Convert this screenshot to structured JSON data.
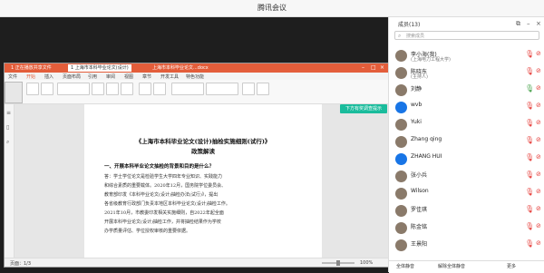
{
  "window": {
    "title": "腾讯会议"
  },
  "app": {
    "tabs": [
      "1 正在播放共享文件",
      "1 上海市本科毕业论文(设计)",
      "上海市本科毕业论文...docx"
    ],
    "ribbon_tabs": [
      "文件",
      "开始",
      "插入",
      "页面布局",
      "引用",
      "审阅",
      "视图",
      "章节",
      "开发工具",
      "特色功能"
    ],
    "active_ribbon_tab": "开始",
    "badge": "下方有奖调查提示",
    "document": {
      "title": "《上海市本科毕业论文(设计)抽检实施细则(试行)》",
      "subtitle": "政策解读",
      "section": "一、开展本科毕业论文抽检的背景和目的是什么？",
      "paragraphs": [
        "答：学士学位论文是检验学生大学四年专业知识、实践能力",
        "和综合素质的重要载体。2020年12月，国务院学位委员会、",
        "教育部印发《本科毕业论文(设计)抽检办法(试行)》，提出",
        "各省级教育行政部门负责本地区本科毕业论文(设计)抽检工作。",
        "2021年10月，市教委印发相关实施细则，自2022年起全面",
        "开展本科毕业论文(设计)抽检工作，并将抽检结果作为学校",
        "办学质量评估、学位授权审核的重要依据。"
      ]
    },
    "status": {
      "page": "页面：1/3",
      "zoom": "100%"
    }
  },
  "participants_panel": {
    "title": "成员(13)",
    "search_placeholder": "搜索成员",
    "members": [
      {
        "name": "李小海(我)",
        "subtitle": "(上海电力工程大学)",
        "avatar_color": "#8a7a6a",
        "mic": "muted"
      },
      {
        "name": "陈晓东",
        "subtitle": "(主持人)",
        "avatar_color": "#8a7a6a",
        "mic": "muted"
      },
      {
        "name": "刘静",
        "subtitle": "",
        "avatar_color": "#8a7a6a",
        "mic": "on"
      },
      {
        "name": "wvb",
        "subtitle": "",
        "avatar_color": "#1875e6",
        "mic": "muted"
      },
      {
        "name": "Yuki",
        "subtitle": "",
        "avatar_color": "#8a7a6a",
        "mic": "muted"
      },
      {
        "name": "Zhang qing",
        "subtitle": "",
        "avatar_color": "#8a7a6a",
        "mic": "muted"
      },
      {
        "name": "ZHANG HUI",
        "subtitle": "",
        "avatar_color": "#1875e6",
        "mic": "muted"
      },
      {
        "name": "张小兵",
        "subtitle": "",
        "avatar_color": "#8a7a6a",
        "mic": "muted"
      },
      {
        "name": "Wilson",
        "subtitle": "",
        "avatar_color": "#8a7a6a",
        "mic": "muted"
      },
      {
        "name": "罗佳琪",
        "subtitle": "",
        "avatar_color": "#8a7a6a",
        "mic": "muted"
      },
      {
        "name": "陈金铭",
        "subtitle": "",
        "avatar_color": "#8a7a6a",
        "mic": "muted"
      },
      {
        "name": "王景阳",
        "subtitle": "",
        "avatar_color": "#8a7a6a",
        "mic": "muted"
      }
    ],
    "footer": {
      "mute_all": "全体静音",
      "unmute_all": "解除全体静音",
      "more": "更多"
    }
  }
}
